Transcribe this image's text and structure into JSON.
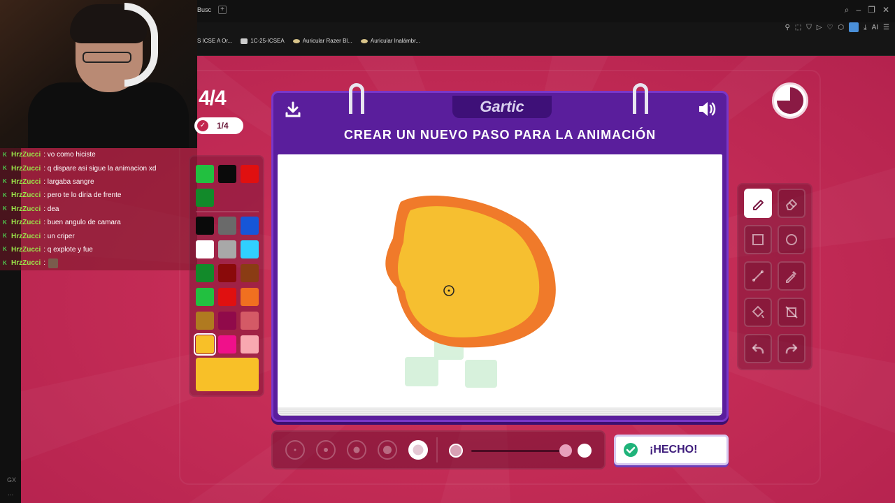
{
  "browser": {
    "tab_fragment": "Busc",
    "tab_add": "+",
    "bookmarks": [
      "S ICSE A Or...",
      "1C-25-ICSEA",
      "Auricular Razer Bl...",
      "Auricular Inalámbr..."
    ],
    "ai_label": "AI",
    "sidebar_gx": "GX",
    "sidebar_more": "..."
  },
  "stream_chat": [
    {
      "user": "HrzZucci",
      "message": ": vo como hiciste"
    },
    {
      "user": "HrzZucci",
      "message": ": q dispare asi sigue la animacion xd"
    },
    {
      "user": "HrzZucci",
      "message": ": largaba sangre"
    },
    {
      "user": "HrzZucci",
      "message": ": pero te lo diria de frente"
    },
    {
      "user": "HrzZucci",
      "message": ": dea"
    },
    {
      "user": "HrzZucci",
      "message": ": buen angulo de camara"
    },
    {
      "user": "HrzZucci",
      "message": ": un criper"
    },
    {
      "user": "HrzZucci",
      "message": ": q explote y fue"
    },
    {
      "user": "HrzZucci",
      "message": ":"
    }
  ],
  "game": {
    "round": "4/4",
    "done_count": "1/4",
    "logo": "Gartic",
    "title": "CREAR UN NUEVO PASO PARA LA ANIMACIÓN",
    "done_button": "¡HECHO!",
    "palette_recent": [
      "#22c040",
      "#0a0a0a",
      "#e01010",
      "#128a2a"
    ],
    "palette": [
      "#0a0a0a",
      "#6a6a6a",
      "#1656d8",
      "#ffffff",
      "#a8a8a8",
      "#30d0ff",
      "#128a2a",
      "#8a0a0a",
      "#8a3c14",
      "#22c040",
      "#e01010",
      "#f07020",
      "#b07a20",
      "#900a4a",
      "#d45a66",
      "#f8c028",
      "#f0108a",
      "#f8a8b0"
    ],
    "selected_color": "#f8c028",
    "tools": [
      "pencil-icon",
      "eraser-icon",
      "rectangle-icon",
      "ellipse-icon",
      "line-icon",
      "eyedropper-icon",
      "fill-bucket-icon",
      "clear-layer-icon",
      "undo-icon",
      "redo-icon"
    ],
    "active_tool": "pencil-icon",
    "brush_sizes": 5,
    "active_brush_size": 5
  }
}
